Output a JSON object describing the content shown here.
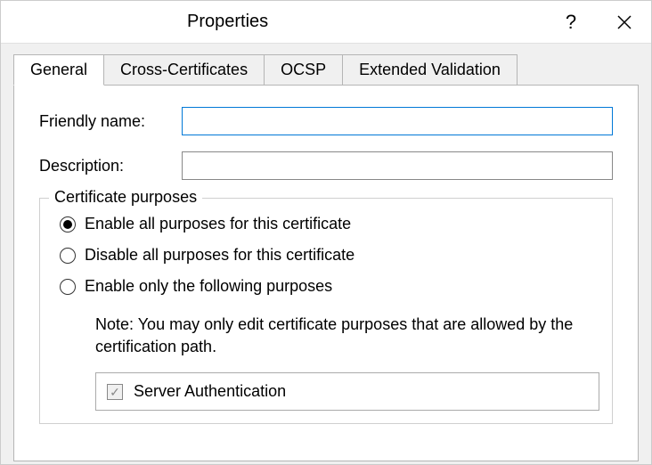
{
  "titlebar": {
    "title": "Properties",
    "help": "?"
  },
  "tabs": {
    "general": "General",
    "cross": "Cross-Certificates",
    "ocsp": "OCSP",
    "ev": "Extended Validation"
  },
  "form": {
    "friendly_label": "Friendly name:",
    "friendly_value": "",
    "description_label": "Description:",
    "description_value": ""
  },
  "purposes": {
    "legend": "Certificate purposes",
    "opt_enable": "Enable all purposes for this certificate",
    "opt_disable": "Disable all purposes for this certificate",
    "opt_only": "Enable only the following purposes",
    "note": "Note: You may only edit certificate purposes that are allowed by the certification path.",
    "items": [
      "Server Authentication"
    ]
  }
}
